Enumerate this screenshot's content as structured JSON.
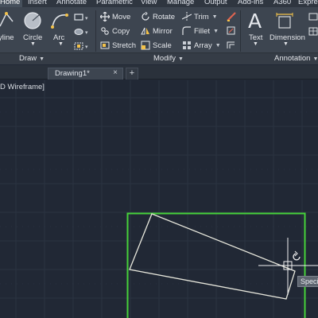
{
  "ribbon_tabs": [
    "Home",
    "Insert",
    "Annotate",
    "Parametric",
    "View",
    "Manage",
    "Output",
    "Add-ins",
    "A360",
    "Expre"
  ],
  "active_tab": "Home",
  "draw_panel": {
    "title": "Draw",
    "polyline_label": "yline",
    "circle_label": "Circle",
    "arc_label": "Arc"
  },
  "modify_panel": {
    "title": "Modify",
    "move": "Move",
    "copy": "Copy",
    "stretch": "Stretch",
    "rotate": "Rotate",
    "mirror": "Mirror",
    "scale": "Scale",
    "trim": "Trim",
    "fillet": "Fillet",
    "array": "Array"
  },
  "annotation_panel": {
    "title": "Annotation",
    "text": "Text",
    "dimension": "Dimension"
  },
  "file_tab": {
    "name": "Drawing1*",
    "close_glyph": "×",
    "new_glyph": "+"
  },
  "viewport": {
    "label": "D Wireframe]",
    "tooltip": "Specif"
  },
  "colors": {
    "accent_yellow": "#f3c24a",
    "selection_green": "#46d23a",
    "canvas": "#212835",
    "ribbon": "#3d4550"
  }
}
